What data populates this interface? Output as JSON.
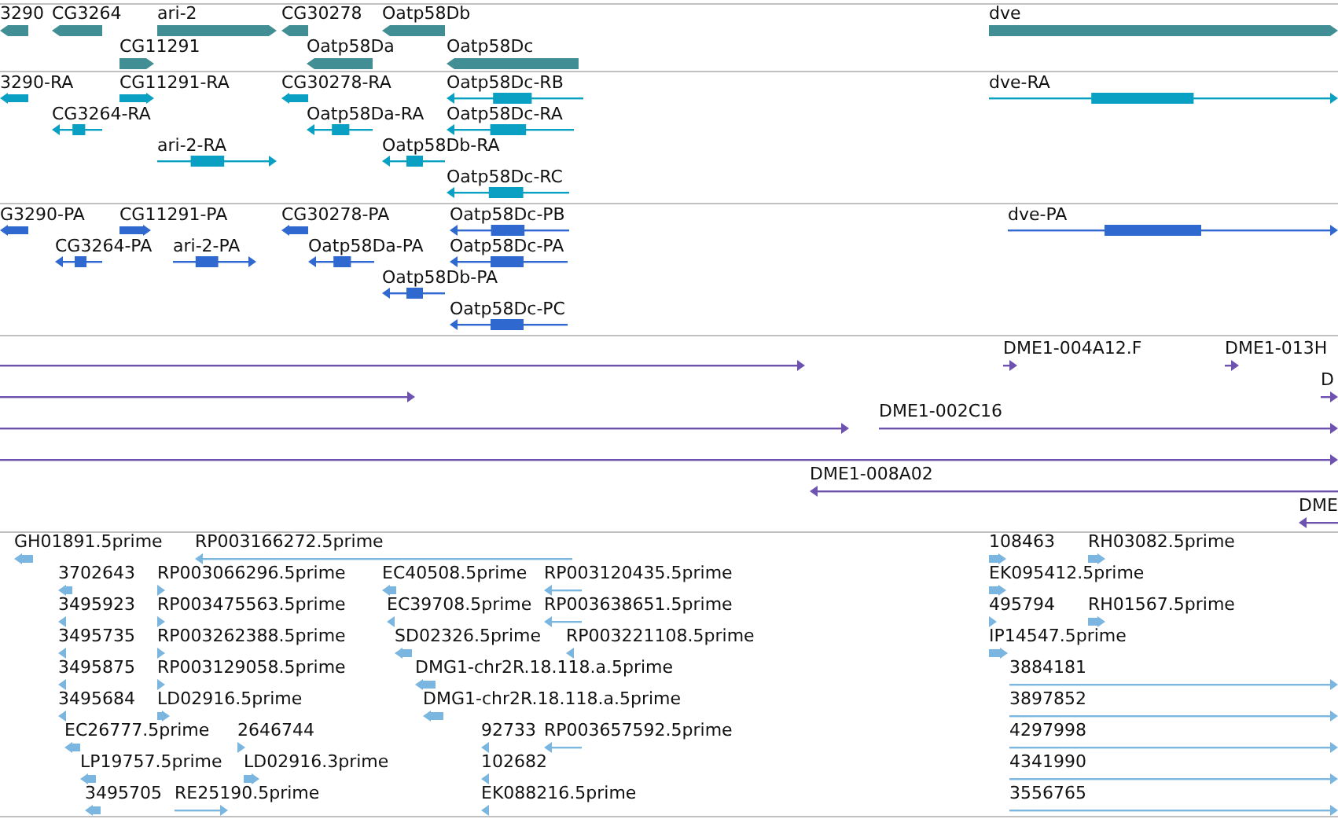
{
  "tracks": [
    {
      "kind": "gene",
      "features": [
        {
          "label": "3290",
          "reverse": true
        },
        {
          "label": "CG3264",
          "reverse": true
        },
        {
          "label": "ari-2",
          "reverse": false
        },
        {
          "label": "CG30278",
          "reverse": true
        },
        {
          "label": "Oatp58Db",
          "reverse": true
        },
        {
          "label": "dve",
          "reverse": false
        },
        {
          "label": "CG11291",
          "reverse": false
        },
        {
          "label": "Oatp58Da",
          "reverse": true
        },
        {
          "label": "Oatp58Dc",
          "reverse": true
        }
      ]
    },
    {
      "kind": "transcript",
      "features": [
        {
          "label": "3290-RA",
          "reverse": true
        },
        {
          "label": "CG11291-RA",
          "reverse": false
        },
        {
          "label": "CG30278-RA",
          "reverse": true
        },
        {
          "label": "Oatp58Dc-RB",
          "reverse": true
        },
        {
          "label": "dve-RA",
          "reverse": false
        },
        {
          "label": "CG3264-RA",
          "reverse": true
        },
        {
          "label": "Oatp58Da-RA",
          "reverse": true
        },
        {
          "label": "Oatp58Dc-RA",
          "reverse": true
        },
        {
          "label": "ari-2-RA",
          "reverse": false
        },
        {
          "label": "Oatp58Db-RA",
          "reverse": true
        },
        {
          "label": "Oatp58Dc-RC",
          "reverse": true
        }
      ]
    },
    {
      "kind": "protein",
      "features": [
        {
          "label": "G3290-PA",
          "reverse": true
        },
        {
          "label": "CG11291-PA",
          "reverse": false
        },
        {
          "label": "CG30278-PA",
          "reverse": true
        },
        {
          "label": "Oatp58Dc-PB",
          "reverse": true
        },
        {
          "label": "dve-PA",
          "reverse": false
        },
        {
          "label": "CG3264-PA",
          "reverse": true
        },
        {
          "label": "ari-2-PA",
          "reverse": false
        },
        {
          "label": "Oatp58Da-PA",
          "reverse": true
        },
        {
          "label": "Oatp58Dc-PA",
          "reverse": true
        },
        {
          "label": "Oatp58Db-PA",
          "reverse": true
        },
        {
          "label": "Oatp58Dc-PC",
          "reverse": true
        }
      ]
    },
    {
      "kind": "clone",
      "features": [
        {
          "reverse": false
        },
        {
          "label": "DME1-004A12.F",
          "reverse": false
        },
        {
          "label": "DME1-013H",
          "reverse": false
        },
        {
          "reverse": false
        },
        {
          "label": "D",
          "reverse": false
        },
        {
          "reverse": false
        },
        {
          "label": "DME1-002C16",
          "reverse": false
        },
        {
          "reverse": false
        },
        {
          "label": "DME1-008A02",
          "reverse": true
        },
        {
          "label": "DME",
          "reverse": true
        }
      ]
    },
    {
      "kind": "est",
      "features": [
        {
          "label": "GH01891.5prime",
          "reverse": true
        },
        {
          "label": "RP003166272.5prime",
          "reverse": true
        },
        {
          "label": "108463",
          "reverse": false
        },
        {
          "label": "RH03082.5prime",
          "reverse": false
        },
        {
          "label": "3702643",
          "reverse": true
        },
        {
          "label": "RP003066296.5prime",
          "reverse": false
        },
        {
          "label": "EC40508.5prime",
          "reverse": true
        },
        {
          "label": "RP003120435.5prime",
          "reverse": true
        },
        {
          "label": "EK095412.5prime",
          "reverse": false
        },
        {
          "label": "3495923",
          "reverse": true
        },
        {
          "label": "RP003475563.5prime",
          "reverse": false
        },
        {
          "label": "EC39708.5prime",
          "reverse": true
        },
        {
          "label": "RP003638651.5prime",
          "reverse": true
        },
        {
          "label": "495794",
          "reverse": false
        },
        {
          "label": "RH01567.5prime",
          "reverse": false
        },
        {
          "label": "3495735",
          "reverse": true
        },
        {
          "label": "RP003262388.5prime",
          "reverse": false
        },
        {
          "label": "SD02326.5prime",
          "reverse": true
        },
        {
          "label": "RP003221108.5prime",
          "reverse": true
        },
        {
          "label": "IP14547.5prime",
          "reverse": false
        },
        {
          "label": "3495875",
          "reverse": true
        },
        {
          "label": "RP003129058.5prime",
          "reverse": false
        },
        {
          "label": "DMG1-chr2R.18.118.a.5prime",
          "reverse": true
        },
        {
          "label": "3884181",
          "reverse": false
        },
        {
          "label": "3495684",
          "reverse": true
        },
        {
          "label": "LD02916.5prime",
          "reverse": false
        },
        {
          "label": "DMG1-chr2R.18.118.a.5prime",
          "reverse": true
        },
        {
          "label": "3897852",
          "reverse": false
        },
        {
          "label": "EC26777.5prime",
          "reverse": true
        },
        {
          "label": "2646744",
          "reverse": false
        },
        {
          "label": "92733",
          "reverse": true
        },
        {
          "label": "RP003657592.5prime",
          "reverse": true
        },
        {
          "label": "4297998",
          "reverse": false
        },
        {
          "label": "LP19757.5prime",
          "reverse": true
        },
        {
          "label": "LD02916.3prime",
          "reverse": false
        },
        {
          "label": "102682",
          "reverse": true
        },
        {
          "label": "4341990",
          "reverse": false
        },
        {
          "label": "3495705",
          "reverse": true
        },
        {
          "label": "RE25190.5prime",
          "reverse": false
        },
        {
          "label": "EK088216.5prime",
          "reverse": true
        },
        {
          "label": "3556765",
          "reverse": false
        }
      ]
    }
  ]
}
